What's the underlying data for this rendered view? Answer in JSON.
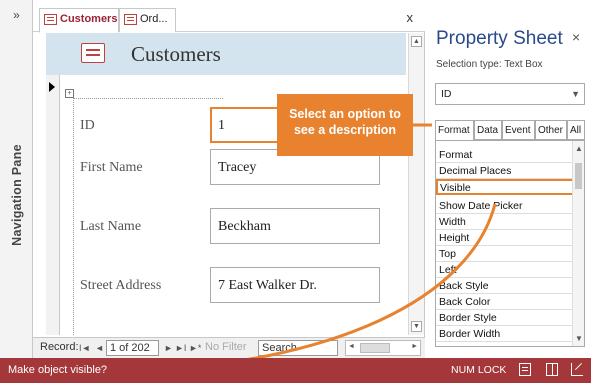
{
  "nav_pane": {
    "toggle": "»",
    "label": "Navigation Pane"
  },
  "tabs": [
    {
      "label": "Customers",
      "active": true
    },
    {
      "label": "Ord...",
      "active": false
    }
  ],
  "doc_close": "x",
  "form": {
    "title": "Customers",
    "fields": [
      {
        "label": "ID",
        "value": "1"
      },
      {
        "label": "First Name",
        "value": "Tracey"
      },
      {
        "label": "Last Name",
        "value": "Beckham"
      },
      {
        "label": "Street Address",
        "value": "7 East Walker Dr."
      }
    ]
  },
  "record_nav": {
    "label": "Record:",
    "first": "I◄",
    "prev": "◄",
    "current": "1 of 202",
    "next": "►",
    "last": "►I",
    "new": "►*",
    "no_filter": "No Filter",
    "search": "Search"
  },
  "property_sheet": {
    "title": "Property Sheet",
    "close": "×",
    "selection_type": "Selection type:  Text Box",
    "selected_object": "ID",
    "tabs": [
      "Format",
      "Data",
      "Event",
      "Other",
      "All"
    ],
    "properties": [
      "Format",
      "Decimal Places",
      "Visible",
      "Show Date Picker",
      "Width",
      "Height",
      "Top",
      "Left",
      "Back Style",
      "Back Color",
      "Border Style",
      "Border Width"
    ],
    "highlighted": "Visible"
  },
  "callout": {
    "text": "Select an option to see a description"
  },
  "status_bar": {
    "text": "Make object visible?",
    "numlock": "NUM LOCK"
  },
  "colors": {
    "accent": "#e8822e",
    "status_bg": "#a4373a",
    "title_blue": "#2a4a8a",
    "form_header_bg": "#d3e4ee"
  }
}
